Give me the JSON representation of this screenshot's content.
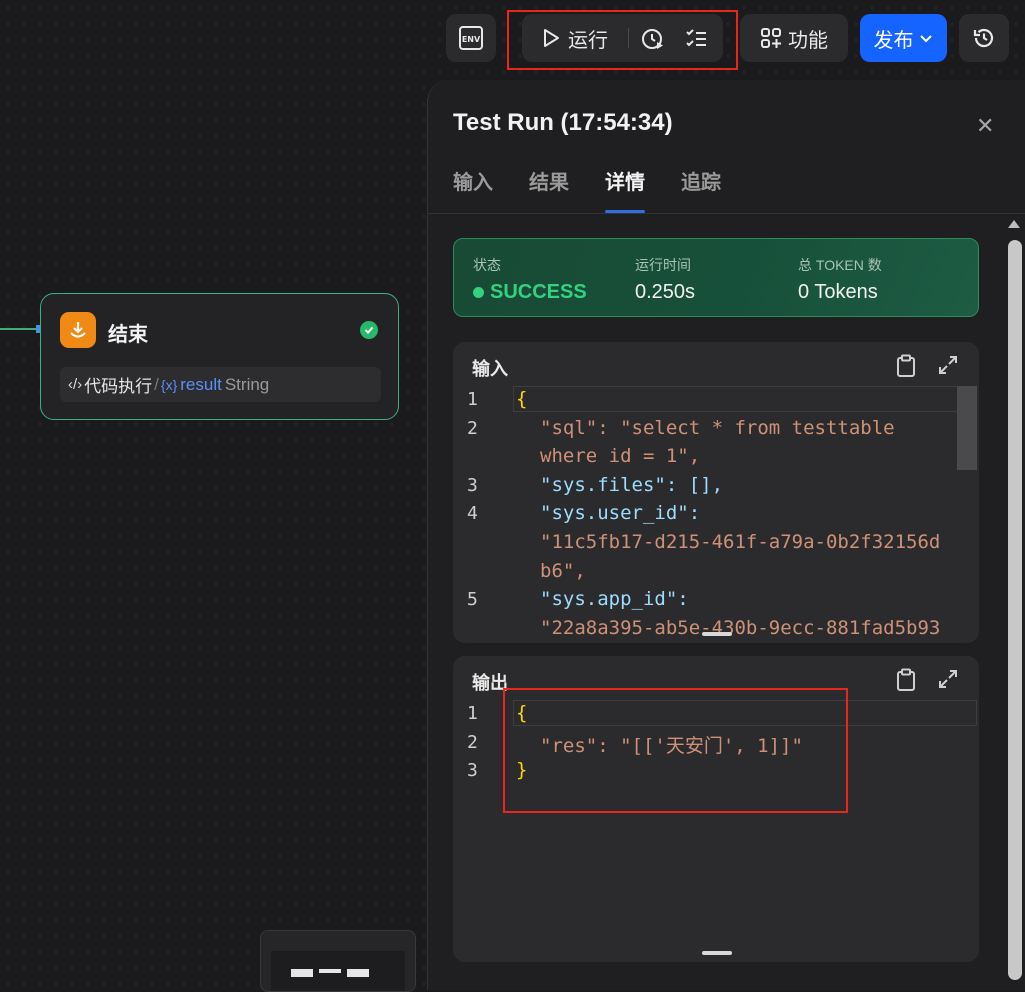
{
  "toolbar": {
    "env_label": "ENV",
    "run_label": "运行",
    "features_label": "功能",
    "publish_label": "发布"
  },
  "node": {
    "title": "结束",
    "var_source": "代码执行",
    "var_separator": "/",
    "var_badge": "{x}",
    "var_name": "result",
    "var_type": "String"
  },
  "panel": {
    "title": "Test Run (17:54:34)",
    "tabs": [
      "输入",
      "结果",
      "详情",
      "追踪"
    ],
    "active_tab": "详情",
    "status": {
      "status_label": "状态",
      "status_value": "SUCCESS",
      "time_label": "运行时间",
      "time_value": "0.250s",
      "token_label": "总 TOKEN 数",
      "token_value": "0 Tokens"
    },
    "input_card": {
      "title": "输入",
      "line_numbers": [
        "1",
        "2",
        "3",
        "4",
        "5"
      ],
      "lines": [
        "{",
        "\"sql\": \"select * from testtable",
        "where id = 1\",",
        "\"sys.files\": [],",
        "\"sys.user_id\":",
        "\"11c5fb17-d215-461f-a79a-0b2f32156d",
        "b6\",",
        "\"sys.app_id\":",
        "\"22a8a395-ab5e-430b-9ecc-881fad5b93"
      ]
    },
    "output_card": {
      "title": "输出",
      "line_numbers": [
        "1",
        "2",
        "3"
      ],
      "lines": [
        "{",
        "\"res\": \"[['天安门', 1]]\"",
        "}"
      ]
    }
  },
  "colors": {
    "highlight_box": "#e8261c",
    "publish_button": "#1664ff",
    "success_green": "#34d17f",
    "node_border": "#3fae7c",
    "node_icon": "#f08a14"
  },
  "icons": [
    "env-icon",
    "play-icon",
    "timer-play-icon",
    "checklist-icon",
    "features-icon",
    "chevron-down-icon",
    "history-icon",
    "close-icon",
    "clipboard-icon",
    "expand-icon",
    "end-node-icon",
    "check-circle-icon",
    "code-icon"
  ]
}
